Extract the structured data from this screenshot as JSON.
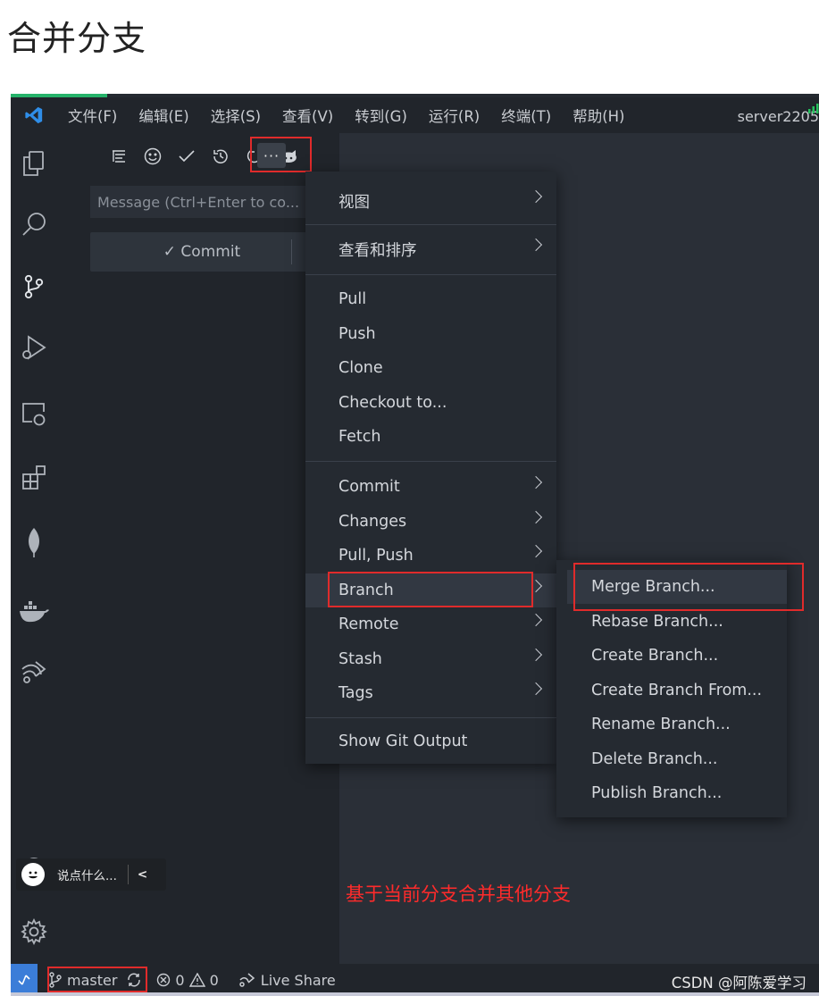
{
  "page": {
    "title": "合并分支"
  },
  "menubar": {
    "items": [
      "文件(F)",
      "编辑(E)",
      "选择(S)",
      "查看(V)",
      "转到(G)",
      "运行(R)",
      "终端(T)",
      "帮助(H)"
    ],
    "server": "server2205"
  },
  "scm": {
    "message_placeholder": "Message (Ctrl+Enter to co...",
    "commit_label": "✓ Commit",
    "more_label": "···"
  },
  "context_menu": {
    "items": [
      {
        "label": "视图",
        "submenu": true
      },
      {
        "label": "查看和排序",
        "submenu": true
      },
      {
        "label": "Pull",
        "submenu": false
      },
      {
        "label": "Push",
        "submenu": false
      },
      {
        "label": "Clone",
        "submenu": false
      },
      {
        "label": "Checkout to...",
        "submenu": false
      },
      {
        "label": "Fetch",
        "submenu": false
      },
      {
        "label": "Commit",
        "submenu": true
      },
      {
        "label": "Changes",
        "submenu": true
      },
      {
        "label": "Pull, Push",
        "submenu": true
      },
      {
        "label": "Branch",
        "submenu": true,
        "hovered": true
      },
      {
        "label": "Remote",
        "submenu": true
      },
      {
        "label": "Stash",
        "submenu": true
      },
      {
        "label": "Tags",
        "submenu": true
      },
      {
        "label": "Show Git Output",
        "submenu": false
      }
    ]
  },
  "branch_submenu": {
    "items": [
      "Merge Branch...",
      "Rebase Branch...",
      "Create Branch...",
      "Create Branch From...",
      "Rename Branch...",
      "Delete Branch...",
      "Publish Branch..."
    ]
  },
  "chat": {
    "label": "说点什么...",
    "collapse": "<"
  },
  "annotation": "基于当前分支合并其他分支",
  "statusbar": {
    "branch": "master",
    "errors": "0",
    "warnings": "0",
    "live_share": "Live Share",
    "watermark": "CSDN @阿陈爱学习"
  },
  "colors": {
    "highlight_box": "#e02b2b",
    "annotation": "#ff2b2b",
    "remote_button": "#3b7dd8",
    "vscode_blue": "#2f8ee8"
  }
}
